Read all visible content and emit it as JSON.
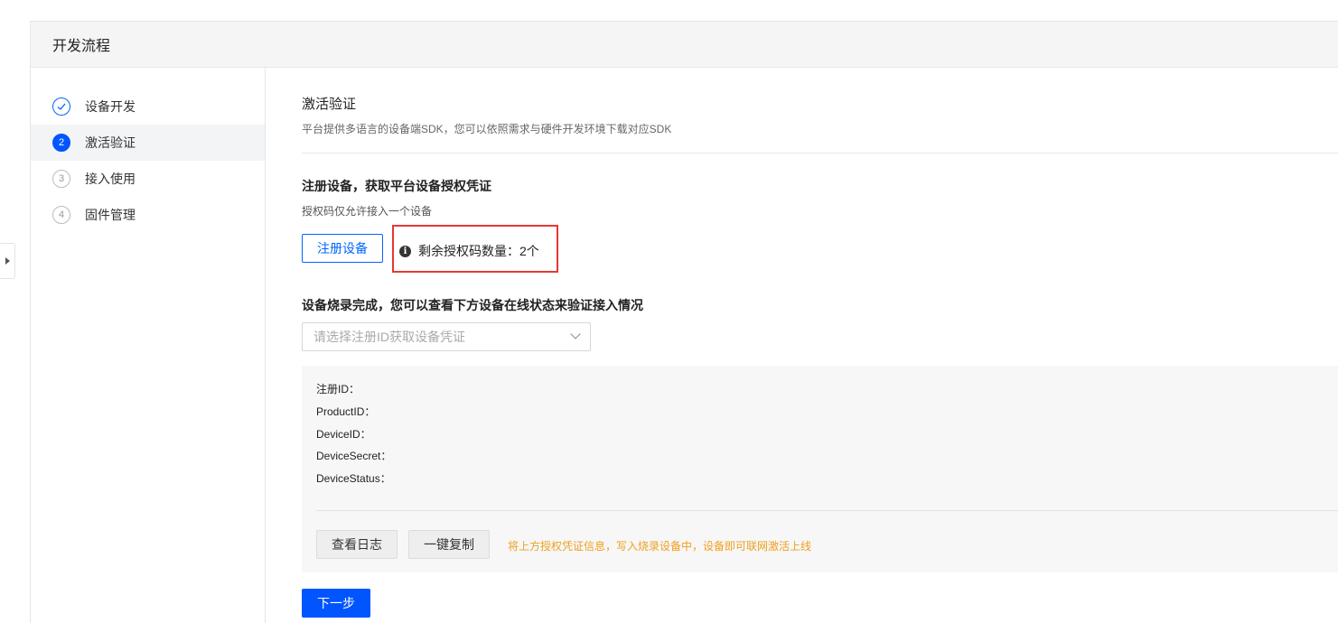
{
  "panel": {
    "title": "开发流程"
  },
  "steps": [
    {
      "marker": "✓",
      "label": "设备开发",
      "state": "done"
    },
    {
      "marker": "2",
      "label": "激活验证",
      "state": "active"
    },
    {
      "marker": "3",
      "label": "接入使用",
      "state": "pending"
    },
    {
      "marker": "4",
      "label": "固件管理",
      "state": "pending"
    }
  ],
  "main": {
    "title": "激活验证",
    "description": "平台提供多语言的设备端SDK，您可以依照需求与硬件开发环境下载对应SDK",
    "register": {
      "title": "注册设备，获取平台设备授权凭证",
      "subtitle": "授权码仅允许接入一个设备",
      "button_label": "注册设备",
      "quota_label": "剩余授权码数量：2个"
    },
    "burn": {
      "title": "设备烧录完成，您可以查看下方设备在线状态来验证接入情况",
      "select_placeholder": "请选择注册ID获取设备凭证"
    },
    "fields": [
      "注册ID：",
      "ProductID：",
      "DeviceID：",
      "DeviceSecret：",
      "DeviceStatus："
    ],
    "actions": {
      "view_log": "查看日志",
      "copy_all": "一键复制",
      "hint": "将上方授权凭证信息，写入烧录设备中，设备即可联网激活上线"
    },
    "next_button": "下一步"
  },
  "colors": {
    "primary": "#0055ff",
    "highlight_box": "#e53935",
    "hint": "#f0a020"
  }
}
